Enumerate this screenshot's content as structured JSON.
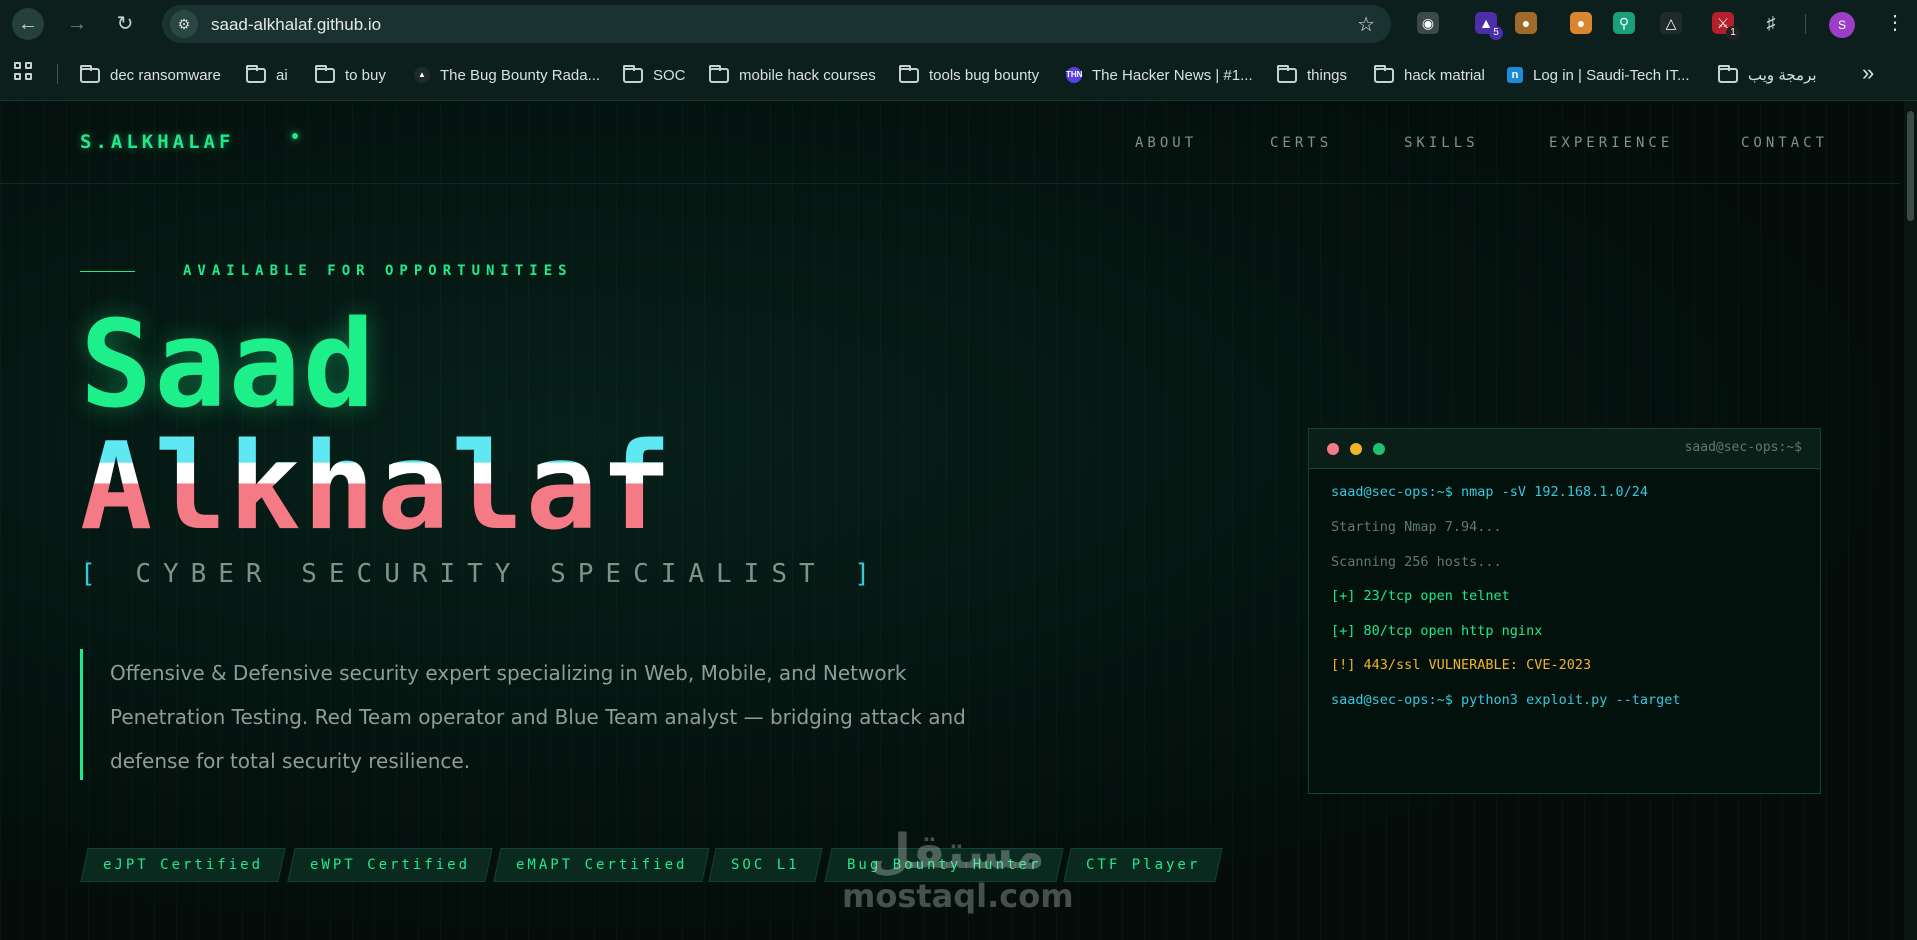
{
  "browser": {
    "url": "saad-alkhalaf.github.io",
    "profile_initial": "S",
    "ext_badges": [
      "5",
      "1"
    ],
    "bookmarks": [
      {
        "label": "dec ransomware",
        "type": "folder"
      },
      {
        "label": "ai",
        "type": "folder"
      },
      {
        "label": "to buy",
        "type": "folder"
      },
      {
        "label": "The Bug Bounty Rada...",
        "type": "site"
      },
      {
        "label": "SOC",
        "type": "folder"
      },
      {
        "label": "mobile hack courses",
        "type": "folder"
      },
      {
        "label": "tools bug bounty",
        "type": "folder"
      },
      {
        "label": "The Hacker News | #1...",
        "type": "site",
        "badge": "THN"
      },
      {
        "label": "things",
        "type": "folder"
      },
      {
        "label": "hack matrial",
        "type": "folder"
      },
      {
        "label": "Log in | Saudi-Tech IT...",
        "type": "site",
        "badge": "n"
      },
      {
        "label": "برمجة ويب",
        "type": "folder"
      }
    ]
  },
  "site": {
    "logo": "S.ALKHALAF",
    "nav": [
      "ABOUT",
      "CERTS",
      "SKILLS",
      "EXPERIENCE",
      "CONTACT"
    ],
    "availability": "AVAILABLE FOR OPPORTUNITIES",
    "name_first": "Saad",
    "name_last": "Alkhalaf",
    "subtitle_open": "[",
    "subtitle": "CYBER SECURITY SPECIALIST",
    "subtitle_close": "]",
    "description": "Offensive & Defensive security expert specializing in Web, Mobile, and Network Penetration Testing. Red Team operator and Blue Team analyst — bridging attack and defense for total security resilience.",
    "tags": [
      "eJPT Certified",
      "eWPT Certified",
      "eMAPT Certified",
      "SOC L1",
      "Bug Bounty Hunter",
      "CTF Player"
    ]
  },
  "terminal": {
    "title": "saad@sec-ops:~$",
    "lines": [
      {
        "text": "saad@sec-ops:~$ nmap -sV 192.168.1.0/24",
        "color": "#37c8e0"
      },
      {
        "text": "Starting Nmap 7.94...",
        "color": "#5c7a70"
      },
      {
        "text": "Scanning 256 hosts...",
        "color": "#5c7a70"
      },
      {
        "text": "[+] 23/tcp open telnet",
        "color": "#20e98a"
      },
      {
        "text": "[+] 80/tcp open http nginx",
        "color": "#20e98a"
      },
      {
        "text": "[!] 443/ssl VULNERABLE: CVE-2023",
        "color": "#f0b429"
      },
      {
        "text": "saad@sec-ops:~$ python3 exploit.py --target",
        "color": "#37c8e0"
      }
    ]
  },
  "watermark": {
    "arabic": "مستقل",
    "latin": "mostaql.com"
  },
  "colors": {
    "accent_green": "#20e98a",
    "accent_cyan": "#37c8e0",
    "accent_pink": "#f47a86",
    "warning_amber": "#f0b429",
    "background": "#050d0a"
  }
}
